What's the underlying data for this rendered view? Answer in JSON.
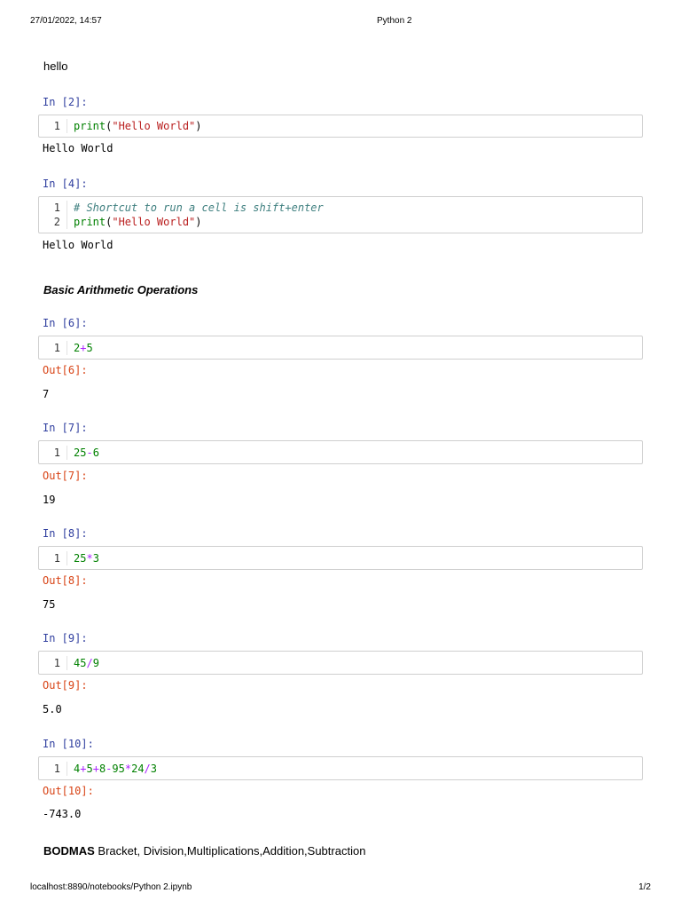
{
  "page_header": {
    "datetime": "27/01/2022, 14:57",
    "title": "Python 2"
  },
  "page_footer": {
    "url": "localhost:8890/notebooks/Python 2.ipynb",
    "page": "1/2"
  },
  "markdown": {
    "hello": "hello",
    "basic_heading": "Basic Arithmetic Operations",
    "bodmas_bold": "BODMAS",
    "bodmas_rest": " Bracket, Division,Multiplications,Addition,Subtraction"
  },
  "cells": [
    {
      "in": "In [2]:",
      "lines": [
        {
          "no": "1",
          "tokens": [
            [
              "fn",
              "print"
            ],
            [
              "p",
              "("
            ],
            [
              "str",
              "\"Hello World\""
            ],
            [
              "p",
              ")"
            ]
          ]
        }
      ],
      "out_prompt": "",
      "output": "Hello World"
    },
    {
      "in": "In [4]:",
      "lines": [
        {
          "no": "1",
          "tokens": [
            [
              "cm",
              "# Shortcut to run a cell is shift+enter"
            ]
          ]
        },
        {
          "no": "2",
          "tokens": [
            [
              "fn",
              "print"
            ],
            [
              "p",
              "("
            ],
            [
              "str",
              "\"Hello World\""
            ],
            [
              "p",
              ")"
            ]
          ]
        }
      ],
      "out_prompt": "",
      "output": "Hello World"
    },
    {
      "in": "In [6]:",
      "lines": [
        {
          "no": "1",
          "tokens": [
            [
              "num",
              "2"
            ],
            [
              "op",
              "+"
            ],
            [
              "num",
              "5"
            ]
          ]
        }
      ],
      "out_prompt": "Out[6]:",
      "output": "7"
    },
    {
      "in": "In [7]:",
      "lines": [
        {
          "no": "1",
          "tokens": [
            [
              "num",
              "25"
            ],
            [
              "op",
              "-"
            ],
            [
              "num",
              "6"
            ]
          ]
        }
      ],
      "out_prompt": "Out[7]:",
      "output": "19"
    },
    {
      "in": "In [8]:",
      "lines": [
        {
          "no": "1",
          "tokens": [
            [
              "num",
              "25"
            ],
            [
              "op",
              "*"
            ],
            [
              "num",
              "3"
            ]
          ]
        }
      ],
      "out_prompt": "Out[8]:",
      "output": "75"
    },
    {
      "in": "In [9]:",
      "lines": [
        {
          "no": "1",
          "tokens": [
            [
              "num",
              "45"
            ],
            [
              "op",
              "/"
            ],
            [
              "num",
              "9"
            ]
          ]
        }
      ],
      "out_prompt": "Out[9]:",
      "output": "5.0"
    },
    {
      "in": "In [10]:",
      "lines": [
        {
          "no": "1",
          "tokens": [
            [
              "num",
              "4"
            ],
            [
              "op",
              "+"
            ],
            [
              "num",
              "5"
            ],
            [
              "op",
              "+"
            ],
            [
              "num",
              "8"
            ],
            [
              "op",
              "-"
            ],
            [
              "num",
              "95"
            ],
            [
              "op",
              "*"
            ],
            [
              "num",
              "24"
            ],
            [
              "op",
              "/"
            ],
            [
              "num",
              "3"
            ]
          ]
        }
      ],
      "out_prompt": "Out[10]:",
      "output": "-743.0"
    }
  ]
}
